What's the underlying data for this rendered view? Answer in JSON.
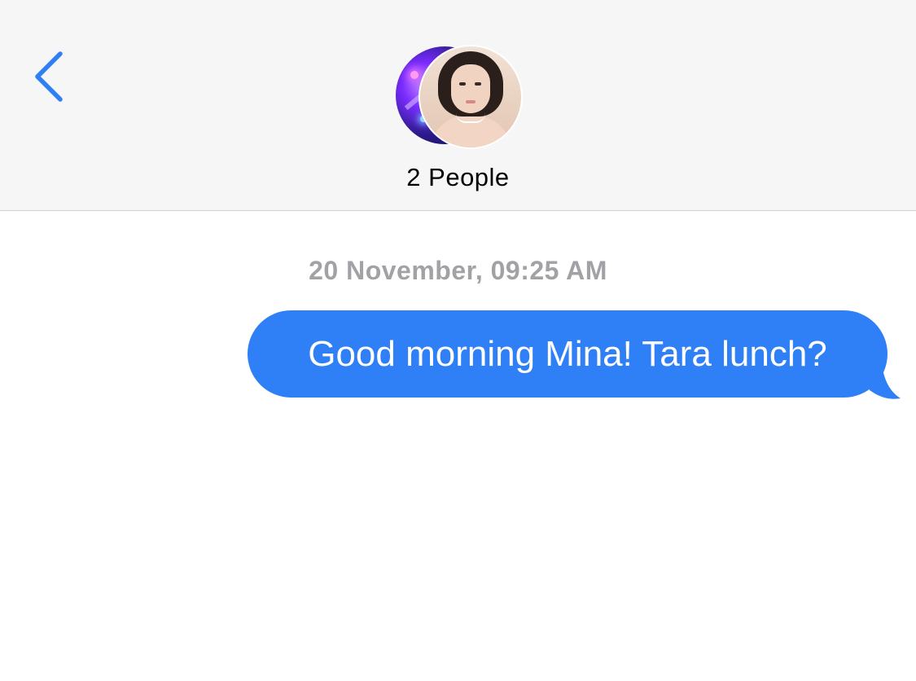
{
  "header": {
    "back_icon": "chevron-left-icon",
    "title": "2 People",
    "accent_color": "#2f7ff6",
    "avatars": [
      {
        "icon": "participant-avatar"
      },
      {
        "icon": "participant-avatar"
      }
    ]
  },
  "conversation": {
    "timestamp": "20 November, 09:25 AM",
    "messages": [
      {
        "direction": "outgoing",
        "text": "Good morning Mina! Tara lunch?",
        "bubble_color": "#2f7ff6"
      }
    ]
  }
}
